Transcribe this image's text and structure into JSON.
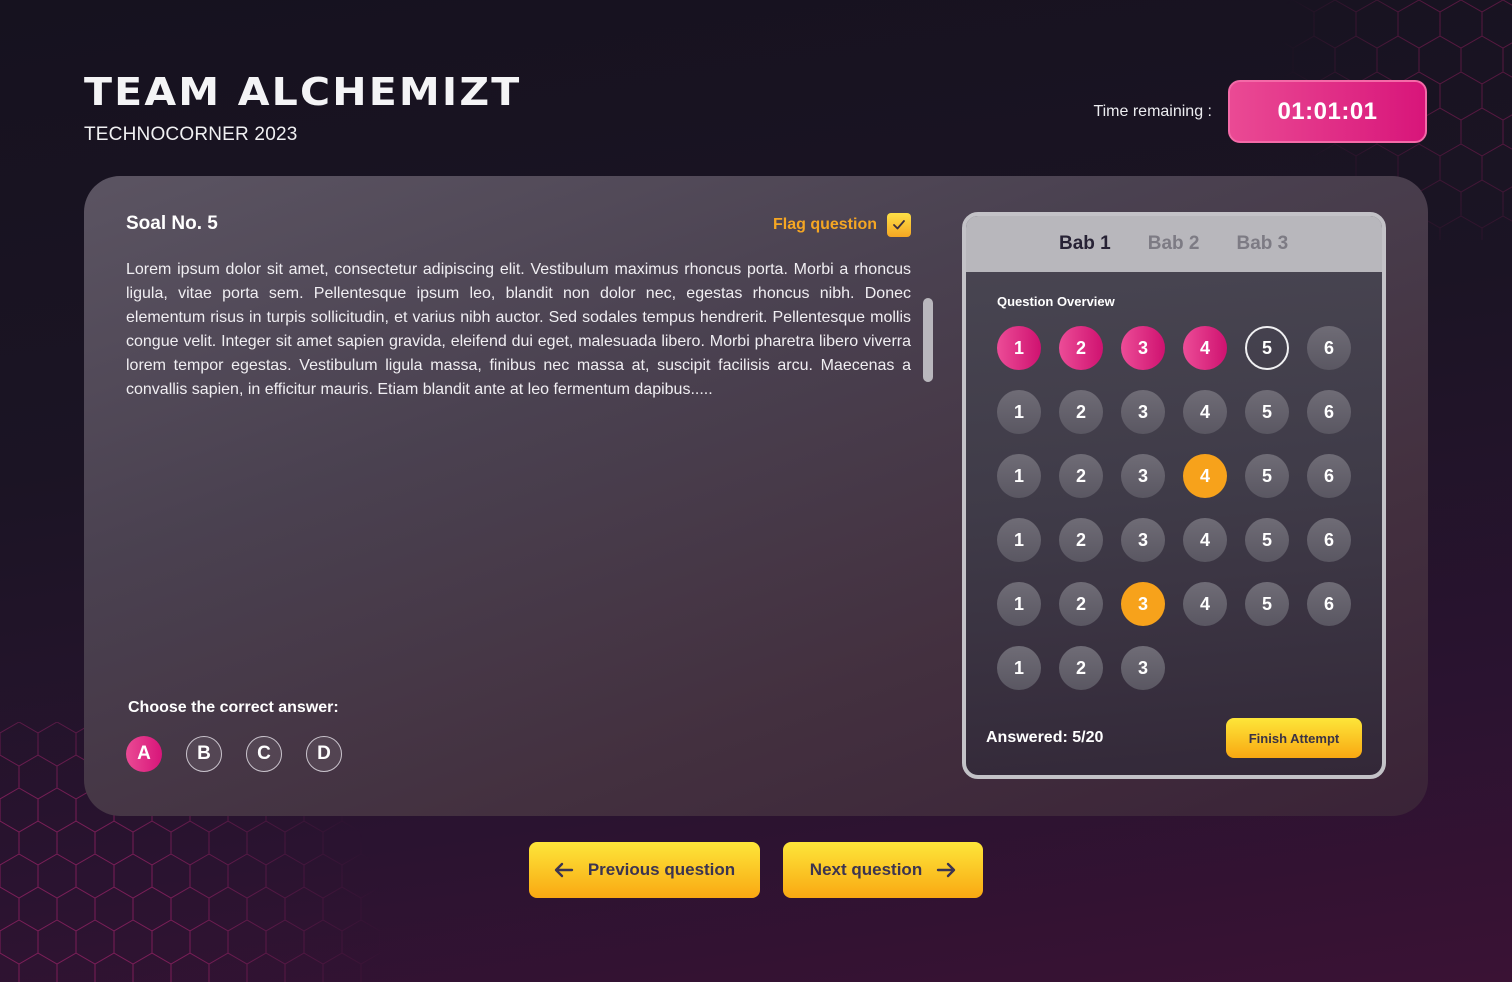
{
  "header": {
    "brand_title": "TEAM ALCHEMIZT",
    "brand_subtitle": "TECHNOCORNER 2023",
    "timer_label": "Time remaining :",
    "timer_value": "01:01:01"
  },
  "question": {
    "title": "Soal No. 5",
    "flag_label": "Flag question",
    "flag_checked": true,
    "text": "Lorem ipsum dolor sit amet, consectetur adipiscing elit. Vestibulum maximus rhoncus porta. Morbi a rhoncus ligula, vitae porta sem. Pellentesque ipsum leo, blandit non dolor nec, egestas rhoncus nibh. Donec elementum risus in turpis sollicitudin, et varius nibh auctor. Sed sodales tempus hendrerit. Pellentesque mollis congue velit. Integer sit amet sapien gravida, eleifend dui eget, malesuada libero. Morbi pharetra libero viverra lorem tempor egestas. Vestibulum ligula massa, finibus nec massa at, suscipit facilisis arcu. Maecenas a convallis sapien, in efficitur mauris. Etiam blandit ante at leo fermentum dapibus.....",
    "answer_label": "Choose the correct answer:",
    "options": [
      {
        "label": "A",
        "selected": true
      },
      {
        "label": "B",
        "selected": false
      },
      {
        "label": "C",
        "selected": false
      },
      {
        "label": "D",
        "selected": false
      }
    ]
  },
  "overview": {
    "tabs": [
      {
        "label": "Bab 1",
        "active": true
      },
      {
        "label": "Bab 2",
        "active": false
      },
      {
        "label": "Bab 3",
        "active": false
      }
    ],
    "title": "Question Overview",
    "rows": [
      [
        {
          "n": "1",
          "state": "answered"
        },
        {
          "n": "2",
          "state": "answered"
        },
        {
          "n": "3",
          "state": "answered"
        },
        {
          "n": "4",
          "state": "answered"
        },
        {
          "n": "5",
          "state": "current"
        },
        {
          "n": "6",
          "state": "default"
        }
      ],
      [
        {
          "n": "1",
          "state": "default"
        },
        {
          "n": "2",
          "state": "default"
        },
        {
          "n": "3",
          "state": "default"
        },
        {
          "n": "4",
          "state": "default"
        },
        {
          "n": "5",
          "state": "default"
        },
        {
          "n": "6",
          "state": "default"
        }
      ],
      [
        {
          "n": "1",
          "state": "default"
        },
        {
          "n": "2",
          "state": "default"
        },
        {
          "n": "3",
          "state": "default"
        },
        {
          "n": "4",
          "state": "flagged"
        },
        {
          "n": "5",
          "state": "default"
        },
        {
          "n": "6",
          "state": "default"
        }
      ],
      [
        {
          "n": "1",
          "state": "default"
        },
        {
          "n": "2",
          "state": "default"
        },
        {
          "n": "3",
          "state": "default"
        },
        {
          "n": "4",
          "state": "default"
        },
        {
          "n": "5",
          "state": "default"
        },
        {
          "n": "6",
          "state": "default"
        }
      ],
      [
        {
          "n": "1",
          "state": "default"
        },
        {
          "n": "2",
          "state": "default"
        },
        {
          "n": "3",
          "state": "flagged"
        },
        {
          "n": "4",
          "state": "default"
        },
        {
          "n": "5",
          "state": "default"
        },
        {
          "n": "6",
          "state": "default"
        }
      ],
      [
        {
          "n": "1",
          "state": "default"
        },
        {
          "n": "2",
          "state": "default"
        },
        {
          "n": "3",
          "state": "default"
        }
      ]
    ],
    "answered_text": "Answered: 5/20",
    "finish_label": "Finish Attempt"
  },
  "nav": {
    "prev_label": "Previous question",
    "next_label": "Next question"
  },
  "colors": {
    "accent_pink": "#d8157a",
    "accent_yellow": "#f9a812",
    "flag_orange": "#f5a623"
  }
}
